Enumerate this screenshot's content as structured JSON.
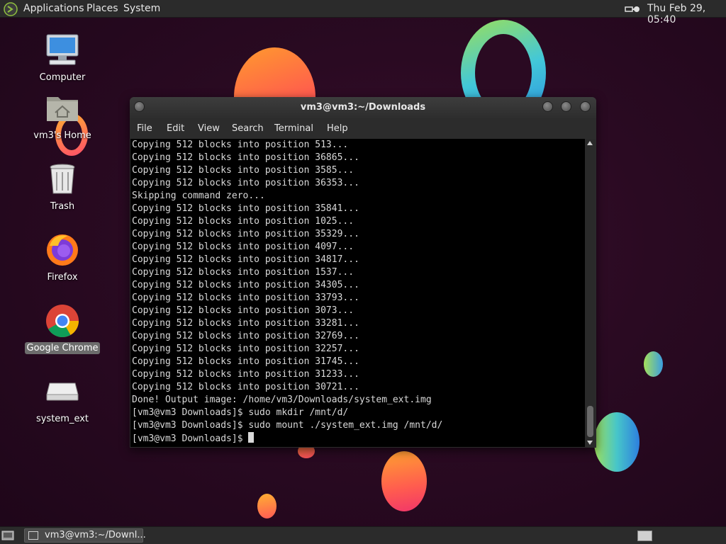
{
  "top_panel": {
    "menus": [
      "Applications",
      "Places",
      "System"
    ],
    "clock": "Thu Feb 29, 05:40"
  },
  "desktop_icons": [
    {
      "label": "Computer",
      "icon": "computer-icon"
    },
    {
      "label": "vm3's Home",
      "icon": "home-folder-icon"
    },
    {
      "label": "Trash",
      "icon": "trash-icon"
    },
    {
      "label": "Firefox",
      "icon": "firefox-icon"
    },
    {
      "label": "Google Chrome",
      "icon": "chrome-icon",
      "selected": true
    },
    {
      "label": "system_ext",
      "icon": "drive-icon"
    }
  ],
  "terminal": {
    "title": "vm3@vm3:~/Downloads",
    "menu": [
      "File",
      "Edit",
      "View",
      "Search",
      "Terminal",
      "Help"
    ],
    "lines": [
      "Copying 512 blocks into position 513...",
      "Copying 512 blocks into position 36865...",
      "Copying 512 blocks into position 3585...",
      "Copying 512 blocks into position 36353...",
      "Skipping command zero...",
      "Copying 512 blocks into position 35841...",
      "Copying 512 blocks into position 1025...",
      "Copying 512 blocks into position 35329...",
      "Copying 512 blocks into position 4097...",
      "Copying 512 blocks into position 34817...",
      "Copying 512 blocks into position 1537...",
      "Copying 512 blocks into position 34305...",
      "Copying 512 blocks into position 33793...",
      "Copying 512 blocks into position 3073...",
      "Copying 512 blocks into position 33281...",
      "Copying 512 blocks into position 32769...",
      "Copying 512 blocks into position 32257...",
      "Copying 512 blocks into position 31745...",
      "Copying 512 blocks into position 31233...",
      "Copying 512 blocks into position 30721...",
      "Done! Output image: /home/vm3/Downloads/system_ext.img",
      "[vm3@vm3 Downloads]$ sudo mkdir /mnt/d/",
      "[vm3@vm3 Downloads]$ sudo mount ./system_ext.img /mnt/d/",
      "[vm3@vm3 Downloads]$ "
    ]
  },
  "bottom_panel": {
    "task_label": "vm3@vm3:~/Downl..."
  },
  "colors": {
    "panel": "#2b2b2b",
    "terminal_bg": "#000000",
    "terminal_text": "#d9d9d9",
    "selection": "#6c6c6c"
  }
}
